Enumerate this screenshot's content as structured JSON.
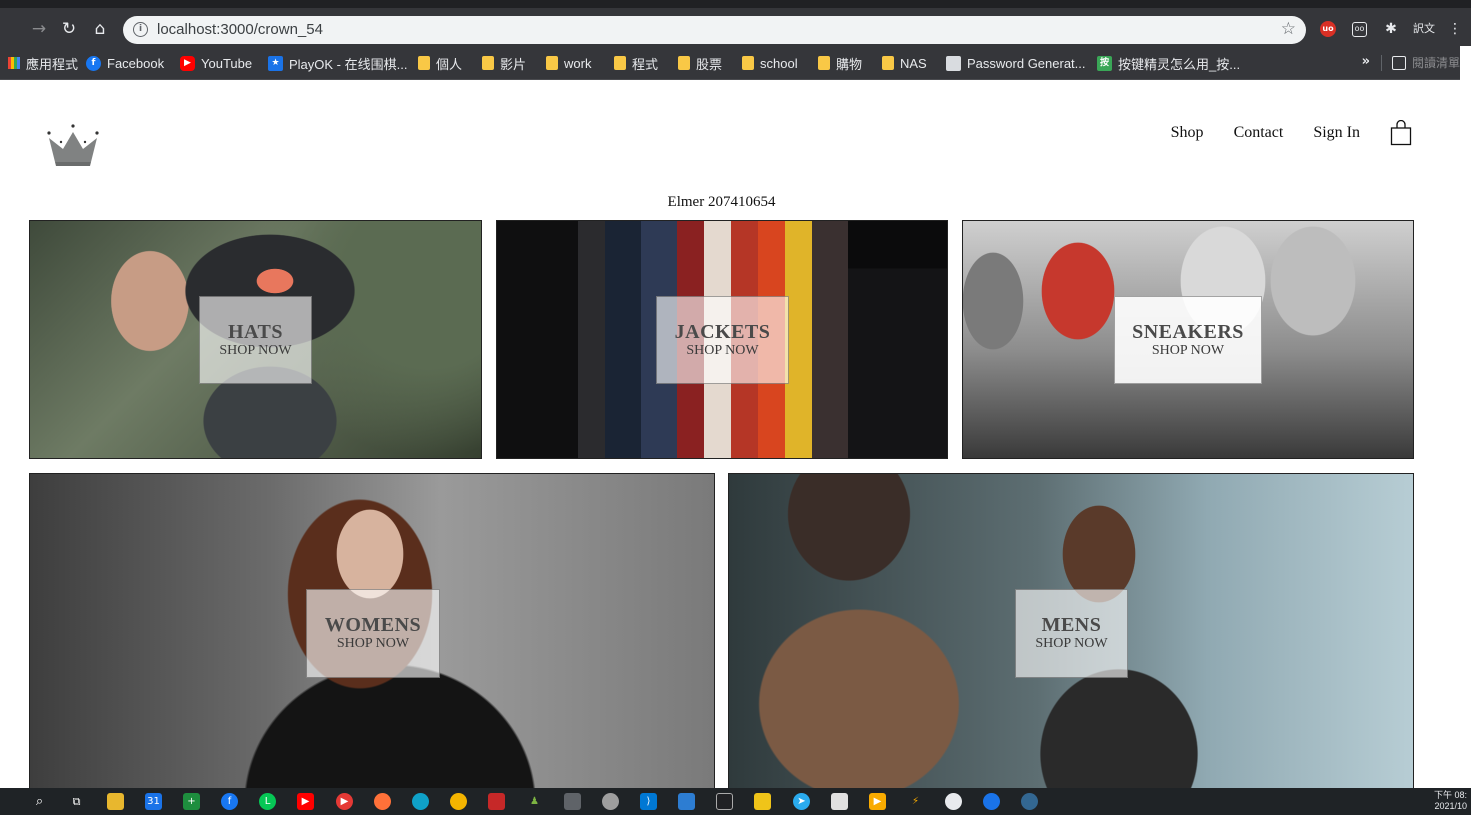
{
  "browser": {
    "url": "localhost:3000/crown_54",
    "icons": {
      "back": "arrow-left-icon",
      "forward": "arrow-right-icon",
      "reload": "reload-icon",
      "home": "home-icon",
      "info": "info-icon",
      "bookmark_star": "star-icon"
    },
    "extensions": {
      "translate_label": "訳文"
    },
    "bookmarks": [
      {
        "label": "應用程式",
        "icon": "apps-grid-icon"
      },
      {
        "label": "Facebook",
        "icon": "facebook-icon",
        "color": "#1877f2"
      },
      {
        "label": "YouTube",
        "icon": "youtube-icon",
        "color": "#ff0000"
      },
      {
        "label": "PlayOK - 在线围棋...",
        "icon": "playok-icon",
        "color": "#1a73e8"
      },
      {
        "label": "個人",
        "icon": "folder-icon"
      },
      {
        "label": "影片",
        "icon": "folder-icon"
      },
      {
        "label": "work",
        "icon": "folder-icon"
      },
      {
        "label": "程式",
        "icon": "folder-icon"
      },
      {
        "label": "股票",
        "icon": "folder-icon"
      },
      {
        "label": "school",
        "icon": "folder-icon"
      },
      {
        "label": "購物",
        "icon": "folder-icon"
      },
      {
        "label": "NAS",
        "icon": "folder-icon"
      },
      {
        "label": "Password Generat...",
        "icon": "page-icon"
      },
      {
        "label": "按键精灵怎么用_按...",
        "icon": "app-icon",
        "color": "#3aa757"
      }
    ],
    "more_label": "»",
    "reading_list_label": "閱讀清單"
  },
  "site": {
    "logo": "crown-logo-icon",
    "nav": {
      "shop": "Shop",
      "contact": "Contact",
      "sign_in": "Sign In",
      "cart_icon": "shopping-bag-icon"
    },
    "user_line": "Elmer 207410654"
  },
  "directory": [
    {
      "title": "HATS",
      "subtitle": "SHOP NOW"
    },
    {
      "title": "JACKETS",
      "subtitle": "SHOP NOW"
    },
    {
      "title": "SNEAKERS",
      "subtitle": "SHOP NOW"
    },
    {
      "title": "WOMENS",
      "subtitle": "SHOP NOW"
    },
    {
      "title": "MENS",
      "subtitle": "SHOP NOW"
    }
  ],
  "taskbar": {
    "clock_time": "下午 08:",
    "clock_date": "2021/10"
  },
  "colors": {
    "chrome_bg": "#35363a",
    "page_bg": "#ffffff",
    "text": "#111111"
  }
}
